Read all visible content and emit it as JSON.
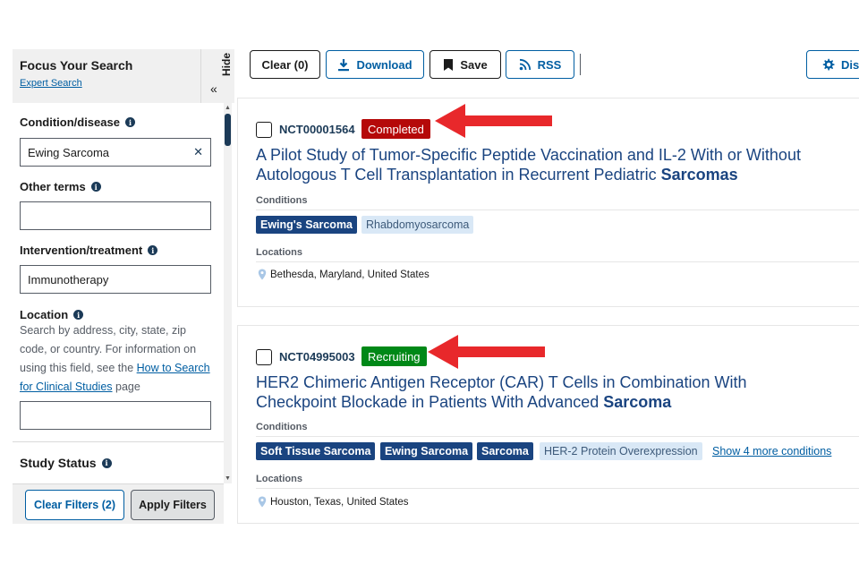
{
  "sidebar": {
    "title": "Focus Your Search",
    "expert_link": "Expert Search",
    "hide_label": "Hide",
    "hide_chevron": "«",
    "condition_label": "Condition/disease",
    "condition_value": "Ewing Sarcoma",
    "other_terms_label": "Other terms",
    "other_terms_value": "",
    "intervention_label": "Intervention/treatment",
    "intervention_value": "Immunotherapy",
    "location_label": "Location",
    "location_help_pre": "Search by address, city, state, zip code, or country. For information on using this field, see the ",
    "location_help_link": "How to Search for Clinical Studies",
    "location_help_post": " page",
    "location_value": "",
    "study_status_label": "Study Status",
    "clear_filters_label": "Clear Filters (2)",
    "apply_filters_label": "Apply Filters"
  },
  "toolbar": {
    "clear_label": "Clear (0)",
    "download_label": "Download",
    "save_label": "Save",
    "rss_label": "RSS",
    "display_label": "Disp"
  },
  "results": [
    {
      "nct": "NCT00001564",
      "status": "Completed",
      "title_plain": "A Pilot Study of Tumor-Specific Peptide Vaccination and IL-2 With or Without Autologous T Cell Transplantation in Recurrent Pediatric ",
      "title_bold": "Sarcomas",
      "conditions_label": "Conditions",
      "conditions": [
        "Ewing's Sarcoma",
        "Rhabdomyosarcoma"
      ],
      "locations_label": "Locations",
      "location": "Bethesda, Maryland, United States"
    },
    {
      "nct": "NCT04995003",
      "status": "Recruiting",
      "title_plain": "HER2 Chimeric Antigen Receptor (CAR) T Cells in Combination With Checkpoint Blockade in Patients With Advanced ",
      "title_bold": "Sarcoma",
      "conditions_label": "Conditions",
      "conditions": [
        "Soft Tissue Sarcoma",
        "Ewing Sarcoma",
        "Sarcoma",
        "HER-2 Protein Overexpression"
      ],
      "more_conditions": "Show 4 more conditions",
      "locations_label": "Locations",
      "location": "Houston, Texas, United States"
    }
  ],
  "colors": {
    "primary_blue": "#005ea2",
    "navy": "#1a4480",
    "status_completed": "#b50909",
    "status_recruiting": "#008817",
    "annotation_arrow": "#e8282b"
  },
  "icons": [
    "info-icon",
    "close-icon",
    "download-icon",
    "bookmark-icon",
    "rss-icon",
    "gear-icon",
    "map-pin-icon",
    "chevron-left-double-icon"
  ]
}
